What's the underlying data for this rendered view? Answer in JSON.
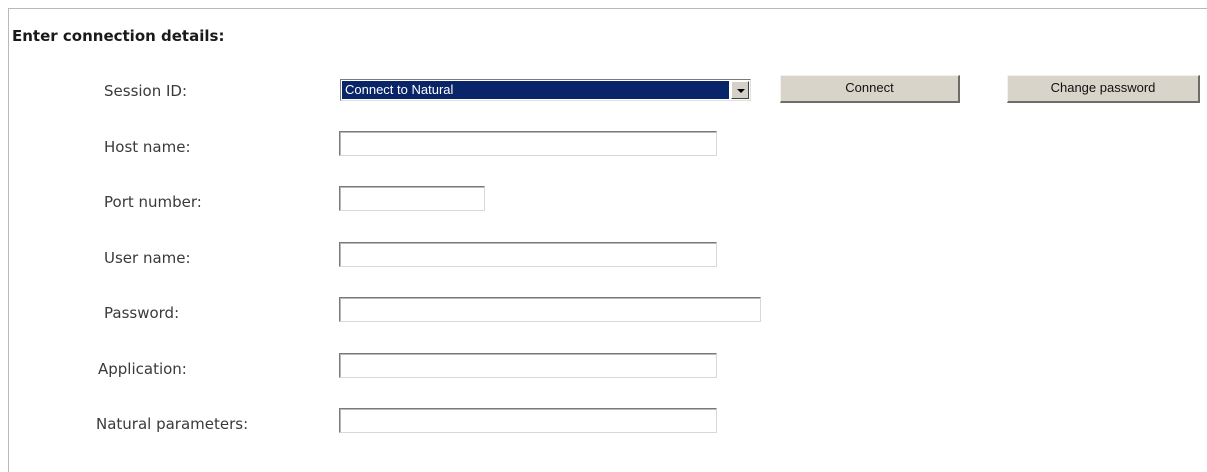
{
  "heading": "Enter connection details:",
  "session": {
    "label": "Session ID:",
    "selected": "Connect to Natural"
  },
  "buttons": {
    "connect": "Connect",
    "change_password": "Change password"
  },
  "fields": {
    "host": {
      "label": "Host name:",
      "value": ""
    },
    "port": {
      "label": "Port number:",
      "value": ""
    },
    "user": {
      "label": "User name:",
      "value": ""
    },
    "password": {
      "label": "Password:",
      "value": ""
    },
    "application": {
      "label": "Application:",
      "value": ""
    },
    "natural_parameters": {
      "label": "Natural parameters:",
      "value": ""
    }
  }
}
